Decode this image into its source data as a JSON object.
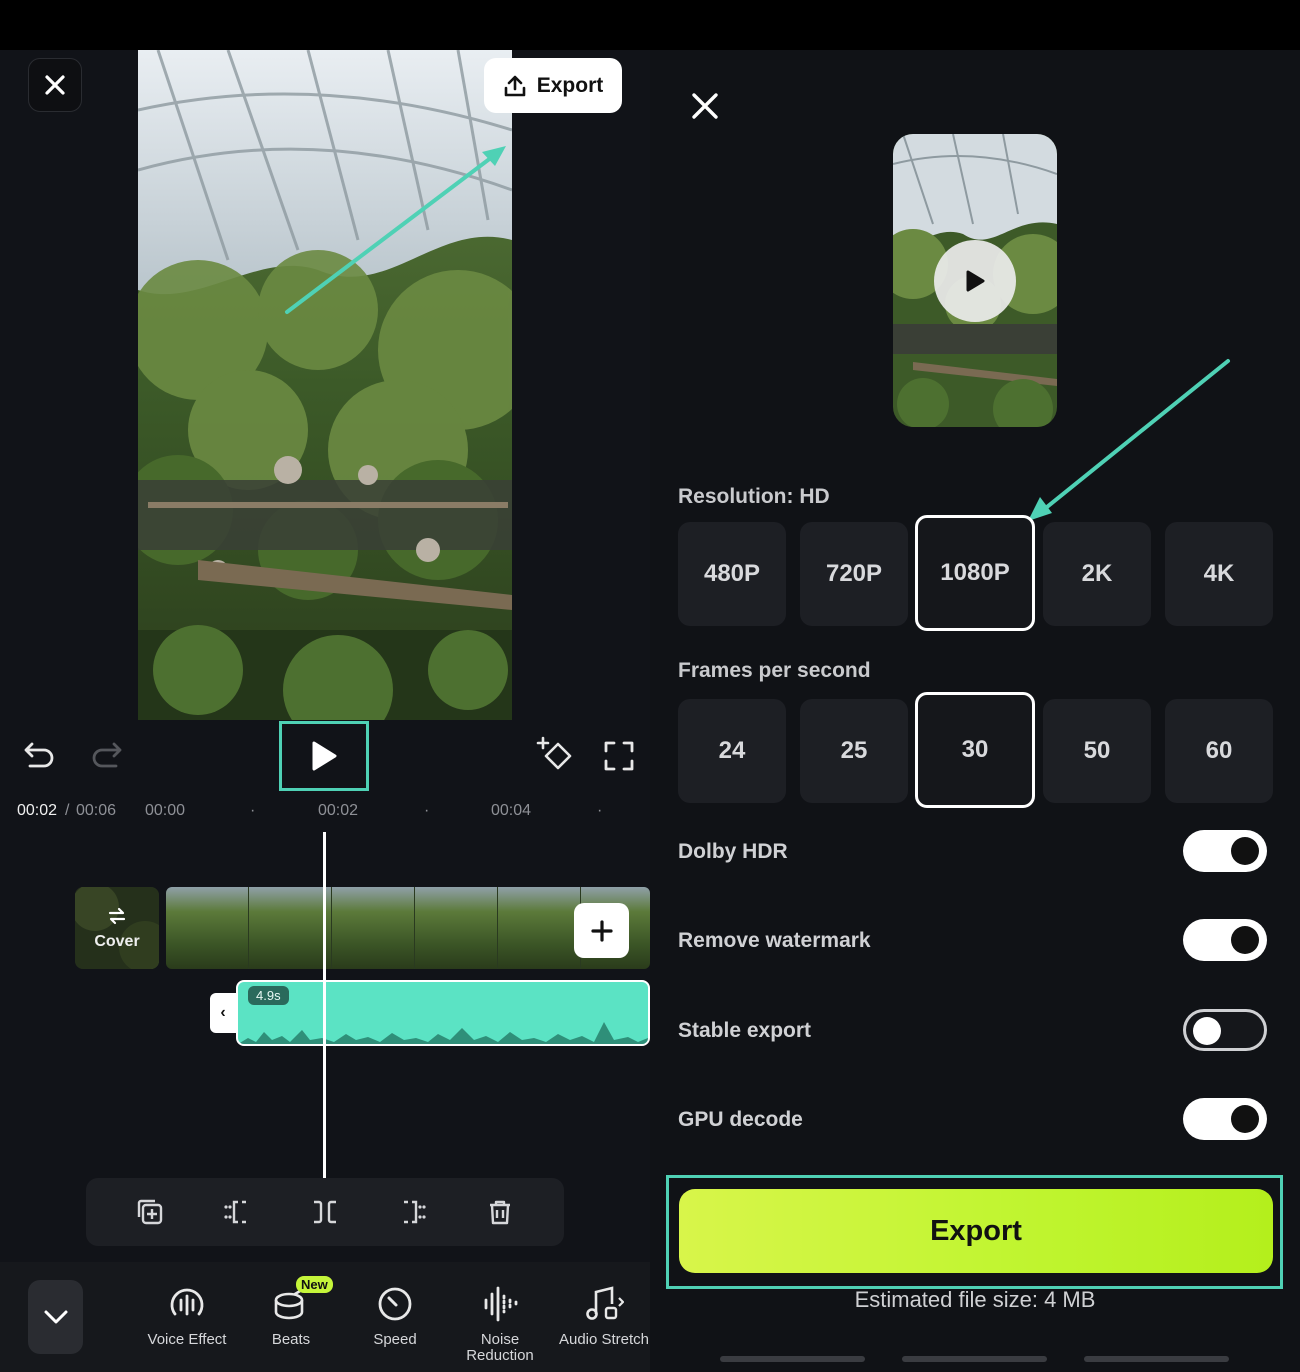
{
  "left": {
    "export_label": "Export",
    "time_current": "00:02",
    "time_sep": "/",
    "time_total": "00:06",
    "ruler": [
      "00:00",
      "00:02",
      "00:04"
    ],
    "cover_label": "Cover",
    "audio_duration": "4.9s",
    "tools": [
      {
        "label": "Voice Effect",
        "icon": "voice-effect-icon"
      },
      {
        "label": "Beats",
        "icon": "beats-icon"
      },
      {
        "label": "Speed",
        "icon": "speed-icon"
      },
      {
        "label": "Noise Reduction",
        "icon": "noise-reduction-icon"
      },
      {
        "label": "Audio Stretch",
        "icon": "audio-stretch-icon"
      }
    ],
    "beats_badge": "New"
  },
  "right": {
    "resolution_label": "Resolution: HD",
    "resolutions": [
      "480P",
      "720P",
      "1080P",
      "2K",
      "4K"
    ],
    "resolution_selected": "1080P",
    "fps_label": "Frames per second",
    "fps": [
      "24",
      "25",
      "30",
      "50",
      "60"
    ],
    "fps_selected": "30",
    "settings": [
      {
        "label": "Dolby HDR",
        "on": true
      },
      {
        "label": "Remove watermark",
        "on": true
      },
      {
        "label": "Stable export",
        "on": false
      },
      {
        "label": "GPU decode",
        "on": true
      }
    ],
    "export_button": "Export",
    "file_size": "Estimated file size: 4 MB"
  },
  "colors": {
    "accent_teal": "#4fd1b5",
    "export_green": "#c1f531",
    "audio_clip": "#5be3c4",
    "background": "#111318"
  }
}
